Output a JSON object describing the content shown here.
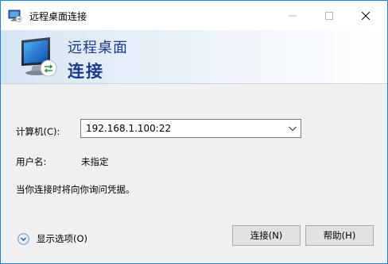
{
  "window": {
    "title": "远程桌面连接",
    "controls": {
      "minimize": "minimize-icon",
      "maximize": "maximize-icon",
      "close": "close-icon"
    }
  },
  "banner": {
    "line1": "远程桌面",
    "line2": "连接",
    "icon": "remote-desktop-monitor-icon"
  },
  "form": {
    "computer_label": "计算机(C):",
    "computer_value": "192.168.1.100:22",
    "user_label": "用户名:",
    "user_value": "未指定",
    "hint": "当你连接时将向你询问凭据。"
  },
  "footer": {
    "options_label": "显示选项(O)",
    "connect_label": "连接(N)",
    "help_label": "帮助(H)"
  },
  "colors": {
    "title_text": "#1e3b8a",
    "window_border": "#1883d7",
    "dialog_bg": "#f0f0f0"
  }
}
